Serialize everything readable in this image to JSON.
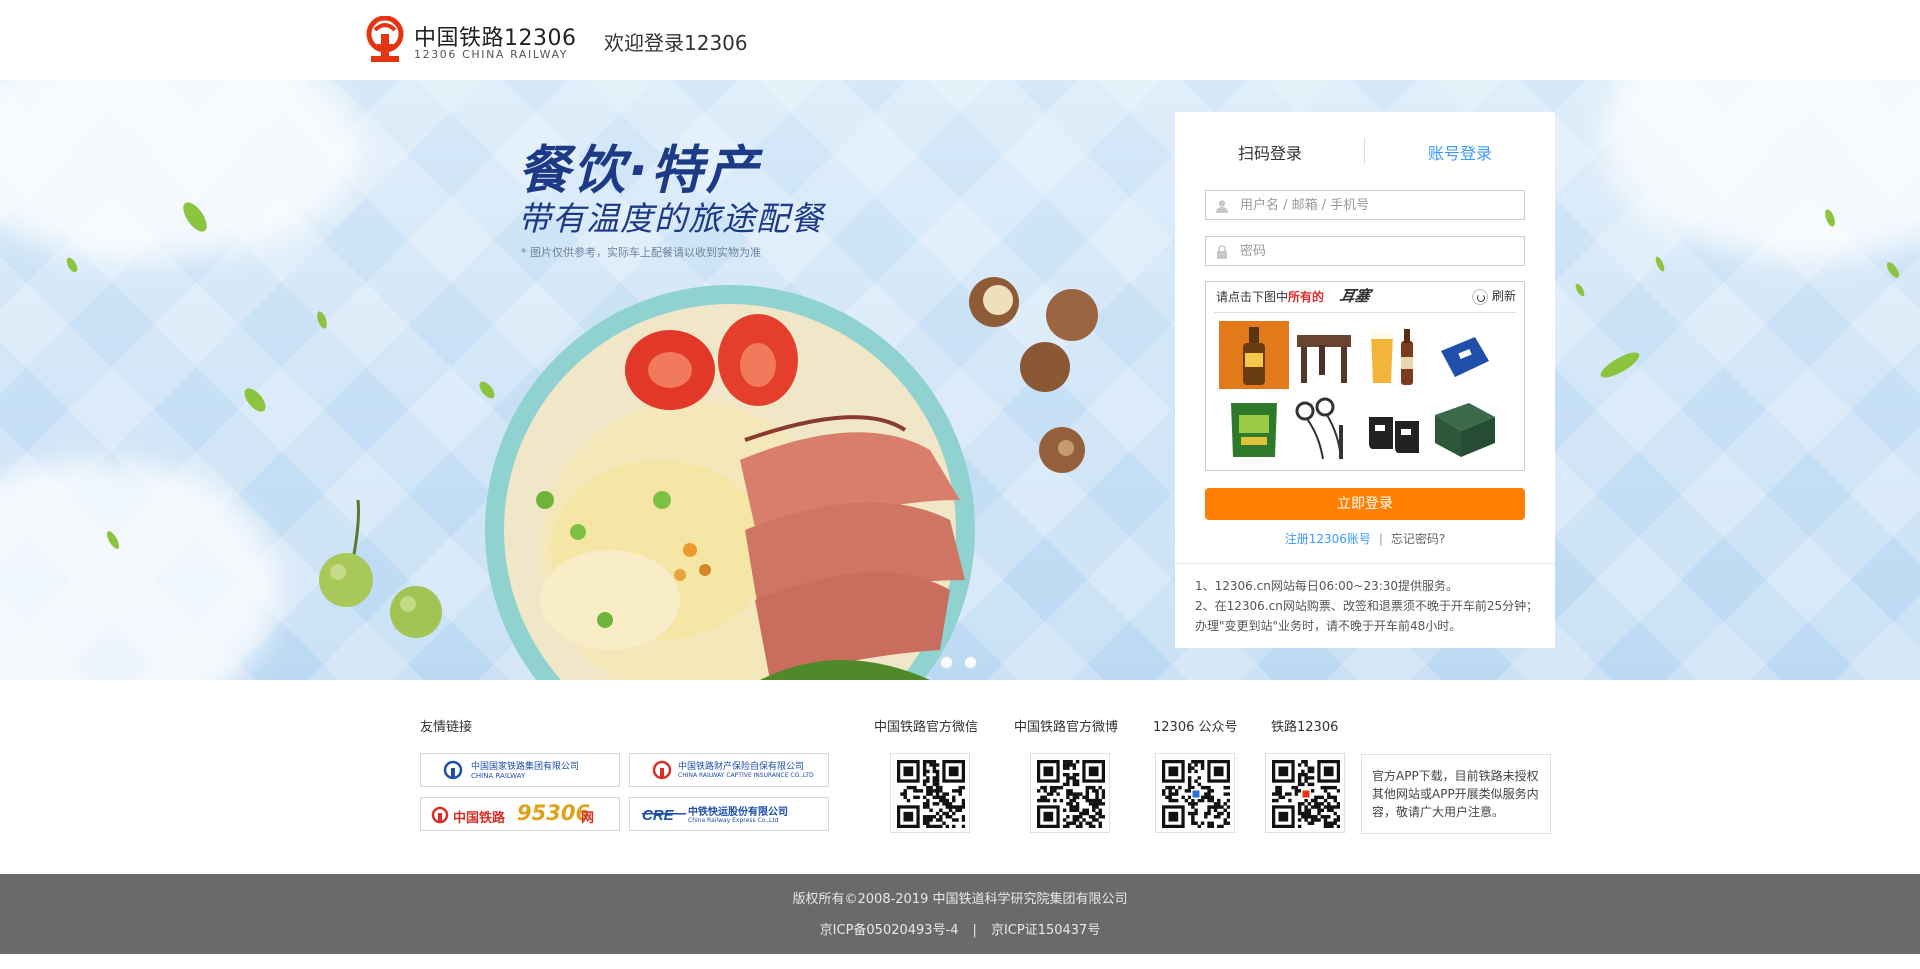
{
  "header": {
    "logo_cn": "中国铁路12306",
    "logo_en": "12306 CHINA RAILWAY",
    "welcome": "欢迎登录12306"
  },
  "colors": {
    "brand_red": "#e63312",
    "accent_blue": "#3b99fc",
    "login_orange": "#ff8000",
    "banner_title_blue": "#1c3a86",
    "footer_gray": "#6a6a6a"
  },
  "banner": {
    "title": "餐饮·特产",
    "subtitle": "带有温度的旅途配餐",
    "note": "* 图片仅供参考，实际车上配餐请以收到实物为准",
    "carousel_dots": 2
  },
  "login": {
    "tabs": [
      {
        "label": "扫码登录",
        "active": false
      },
      {
        "label": "账号登录",
        "active": true
      }
    ],
    "username_placeholder": "用户名 / 邮箱 / 手机号",
    "password_placeholder": "密码",
    "captcha": {
      "prompt_prefix": "请点击下图中",
      "prompt_highlight": "所有的",
      "target_word": "耳塞",
      "refresh_label": "刷新",
      "images": [
        "beer-bottle",
        "wooden-stool",
        "beer-glass",
        "blue-wristband",
        "green-snack-bag",
        "earphones",
        "adidas-socks",
        "green-gift-box"
      ]
    },
    "submit_label": "立即登录",
    "register_link": "注册12306账号",
    "separator": "|",
    "forgot_link": "忘记密码?",
    "notices": [
      "1、12306.cn网站每日06:00~23:30提供服务。",
      "2、在12306.cn网站购票、改签和退票须不晚于开车前25分钟；办理\"变更到站\"业务时，请不晚于开车前48小时。"
    ]
  },
  "links_section": {
    "title": "友情链接",
    "partners": [
      {
        "name": "中国国家铁路集团有限公司",
        "sub": "CHINA RAILWAY"
      },
      {
        "name": "中国铁路财产保险自保有限公司",
        "sub": "CHINA RAILWAY CAPTIVE INSURANCE CO.,LTD"
      },
      {
        "name": "中国铁路",
        "extra": "95306",
        "suffix": "网"
      },
      {
        "name": "中铁快运股份有限公司",
        "sub": "China Railway Express Co.,Ltd"
      }
    ]
  },
  "qr_section": {
    "items": [
      {
        "title": "中国铁路官方微信"
      },
      {
        "title": "中国铁路官方微博"
      },
      {
        "title": "12306 公众号"
      },
      {
        "title": "铁路12306"
      }
    ],
    "app_note": "官方APP下载，目前铁路未授权其他网站或APP开展类似服务内容，敬请广大用户注意。"
  },
  "footer": {
    "copyright": "版权所有©2008-2019    中国铁道科学研究院集团有限公司",
    "icp1": "京ICP备05020493号-4",
    "sep": "|",
    "icp2": "京ICP证150437号"
  }
}
